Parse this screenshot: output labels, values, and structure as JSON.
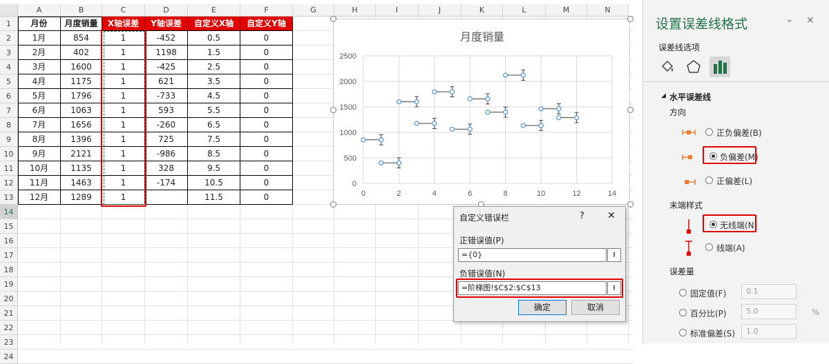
{
  "sheet": {
    "columns": [
      "A",
      "B",
      "C",
      "D",
      "E",
      "F",
      "G",
      "H",
      "I",
      "J",
      "K",
      "L",
      "M",
      "N"
    ],
    "rows": [
      "1",
      "2",
      "3",
      "4",
      "5",
      "6",
      "7",
      "8",
      "9",
      "10",
      "11",
      "12",
      "13",
      "14",
      "15",
      "16",
      "17",
      "18",
      "19",
      "20",
      "21",
      "22",
      "23",
      "24"
    ],
    "headers": [
      "月份",
      "月度销量",
      "X轴误差",
      "Y轴误差",
      "自定义X轴",
      "自定义Y轴"
    ],
    "data": [
      [
        "1月",
        "854",
        "1",
        "-452",
        "0.5",
        "0"
      ],
      [
        "2月",
        "402",
        "1",
        "1198",
        "1.5",
        "0"
      ],
      [
        "3月",
        "1600",
        "1",
        "-425",
        "2.5",
        "0"
      ],
      [
        "4月",
        "1175",
        "1",
        "621",
        "3.5",
        "0"
      ],
      [
        "5月",
        "1796",
        "1",
        "-733",
        "4.5",
        "0"
      ],
      [
        "6月",
        "1063",
        "1",
        "593",
        "5.5",
        "0"
      ],
      [
        "7月",
        "1656",
        "1",
        "-260",
        "6.5",
        "0"
      ],
      [
        "8月",
        "1396",
        "1",
        "725",
        "7.5",
        "0"
      ],
      [
        "9月",
        "2121",
        "1",
        "-986",
        "8.5",
        "0"
      ],
      [
        "10月",
        "1135",
        "1",
        "328",
        "9.5",
        "0"
      ],
      [
        "11月",
        "1463",
        "1",
        "-174",
        "10.5",
        "0"
      ],
      [
        "12月",
        "1289",
        "1",
        "",
        "11.5",
        "0"
      ]
    ]
  },
  "chart_data": {
    "type": "scatter",
    "title": "月度销量",
    "xlim": [
      0,
      14
    ],
    "ylim": [
      0,
      2500
    ],
    "xticks": [
      "0",
      "2",
      "4",
      "6",
      "8",
      "10",
      "12",
      "14"
    ],
    "yticks": [
      "0",
      "500",
      "1000",
      "1500",
      "2000",
      "2500"
    ],
    "grid": true,
    "x": [
      1,
      2,
      3,
      4,
      5,
      6,
      7,
      8,
      9,
      10,
      11,
      12
    ],
    "y": [
      854,
      402,
      1600,
      1175,
      1796,
      1063,
      1656,
      1396,
      2121,
      1135,
      1463,
      1289
    ],
    "x_error_minus": [
      1,
      1,
      1,
      1,
      1,
      1,
      1,
      1,
      1,
      1,
      1,
      1
    ],
    "y_error": [
      100,
      100,
      100,
      100,
      100,
      100,
      100,
      100,
      100,
      100,
      100,
      100
    ],
    "marker_color": "#5b9bd5"
  },
  "dialog": {
    "title": "自定义错误栏",
    "help": "?",
    "close": "✕",
    "pos_label": "正错误值(P)",
    "pos_value": "={0}",
    "neg_label": "负错误值(N)",
    "neg_value": "=阶梯图!$C$2:$C$13",
    "ok": "确定",
    "cancel": "取消",
    "pick_icon": "⭱"
  },
  "pane": {
    "title": "设置误差线格式",
    "collapse_icon": "⌄",
    "close_icon": "✕",
    "subtitle": "误差线选项",
    "section": "水平误差线",
    "direction_label": "方向",
    "dir_both": "正负偏差(B)",
    "dir_minus": "负偏差(M)",
    "dir_plus": "正偏差(L)",
    "endstyle_label": "末端样式",
    "end_none": "无线端(N)",
    "end_cap": "线端(A)",
    "amount_label": "误差量",
    "fixed": "固定值(F)",
    "fixed_value": "0.1",
    "percent": "百分比(P)",
    "percent_value": "5.0",
    "percent_unit": "%",
    "stdev": "标准偏差(S)",
    "stdev_value": "1.0",
    "accent": "#217346",
    "orange": "#ed7d31"
  }
}
